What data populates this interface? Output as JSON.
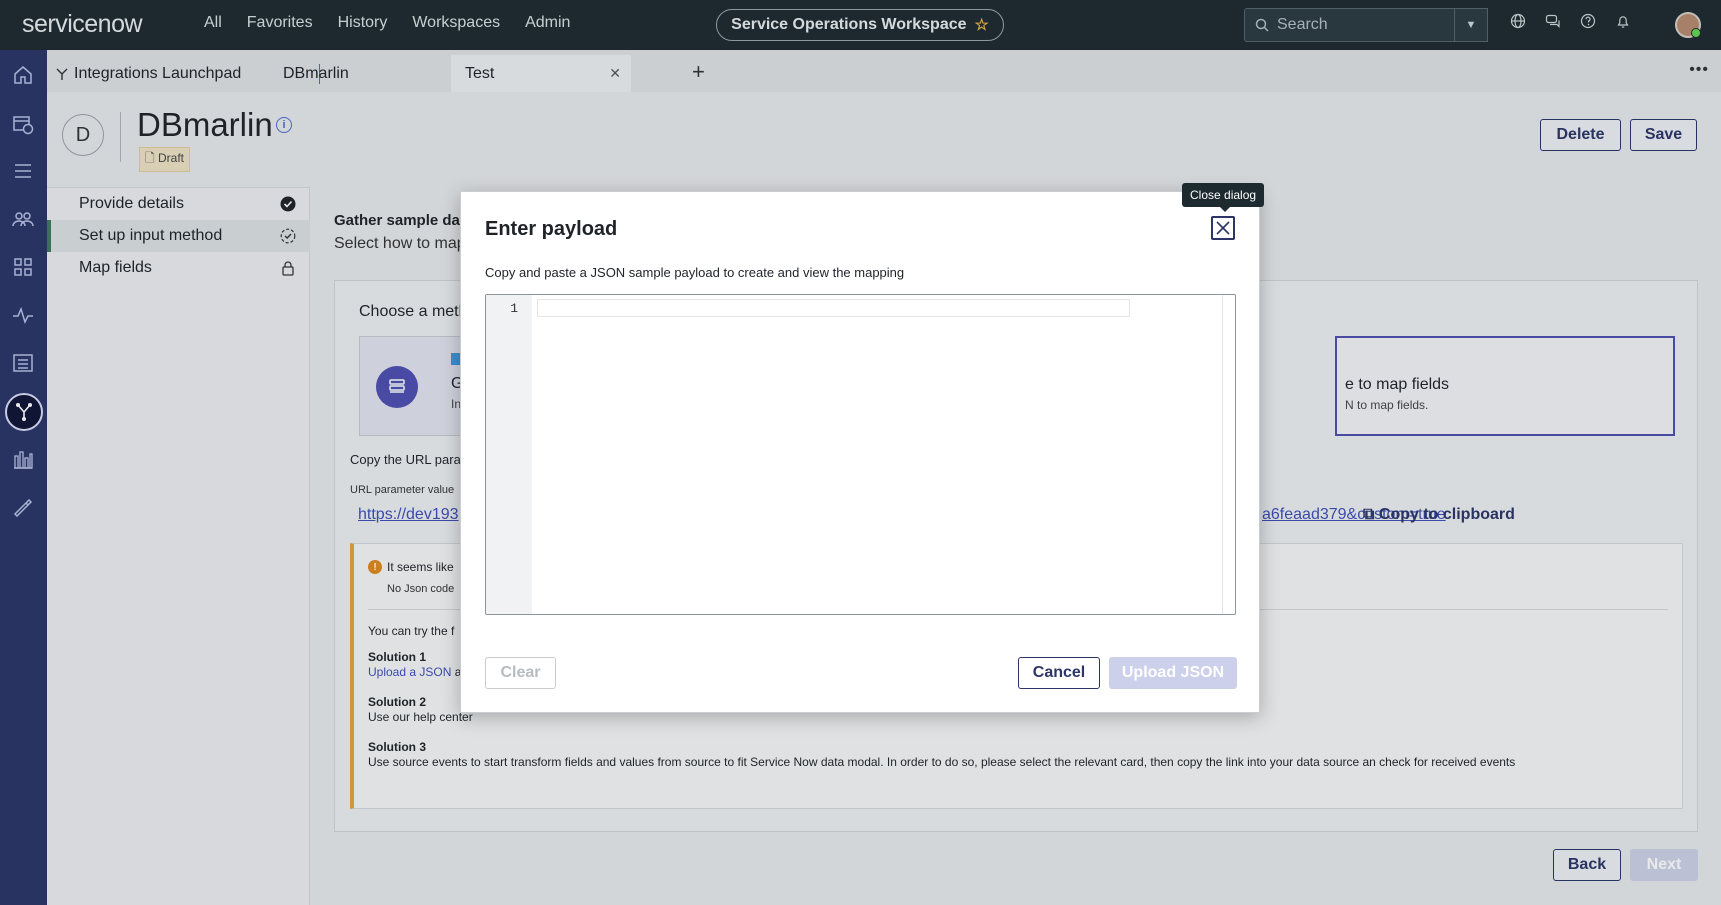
{
  "topnav": {
    "logo_text": "servicenow",
    "links": [
      "All",
      "Favorites",
      "History",
      "Workspaces",
      "Admin"
    ],
    "workspace_title": "Service Operations Workspace",
    "search_placeholder": "Search"
  },
  "tabs": [
    {
      "label": "Integrations Launchpad"
    },
    {
      "label": "DBmarlin"
    },
    {
      "label": "Test"
    }
  ],
  "record": {
    "avatar_letter": "D",
    "title": "DBmarlin",
    "status": "Draft",
    "delete_label": "Delete",
    "save_label": "Save"
  },
  "steps": [
    {
      "label": "Provide details",
      "state": "complete"
    },
    {
      "label": "Set up input method",
      "state": "in-progress"
    },
    {
      "label": "Map fields",
      "state": "locked"
    }
  ],
  "main": {
    "heading": "Gather sample dat",
    "subheading": "Select how to map",
    "choose_method": "Choose a meth",
    "card_left_title": "G",
    "card_left_sub": "In",
    "card_right_title": "e to map fields",
    "card_right_sub": "N to map fields.",
    "copy_url_text": "Copy the URL para",
    "url_param_label": "URL parameter value",
    "url_left": "https://dev193",
    "url_right": "a6feaad379&custom=true",
    "copy_clipboard": "Copy to clipboard",
    "warning_title": "It seems like",
    "warning_sub": "No Json code",
    "try_text": "You can try the f",
    "solution1_title": "Solution 1",
    "solution1_link": "Upload a JSON",
    "solution1_rest": " a",
    "solution2_title": "Solution 2",
    "solution2_desc": "Use our help center",
    "solution3_title": "Solution 3",
    "solution3_desc": "Use source events to start transform fields and values from source to fit Service Now data modal. In order to do so, please select the relevant card, then copy the link into your data source an check for received events",
    "back_label": "Back",
    "next_label": "Next"
  },
  "modal": {
    "title": "Enter payload",
    "description": "Copy and paste a JSON sample payload to create and view the mapping",
    "line_number": "1",
    "close_tooltip": "Close dialog",
    "clear_label": "Clear",
    "cancel_label": "Cancel",
    "upload_label": "Upload JSON"
  },
  "colors": {
    "nav_bg": "#1d2a2f",
    "rail_bg": "#2b3567",
    "accent": "#2b3567",
    "brand_green": "#62d84e"
  }
}
